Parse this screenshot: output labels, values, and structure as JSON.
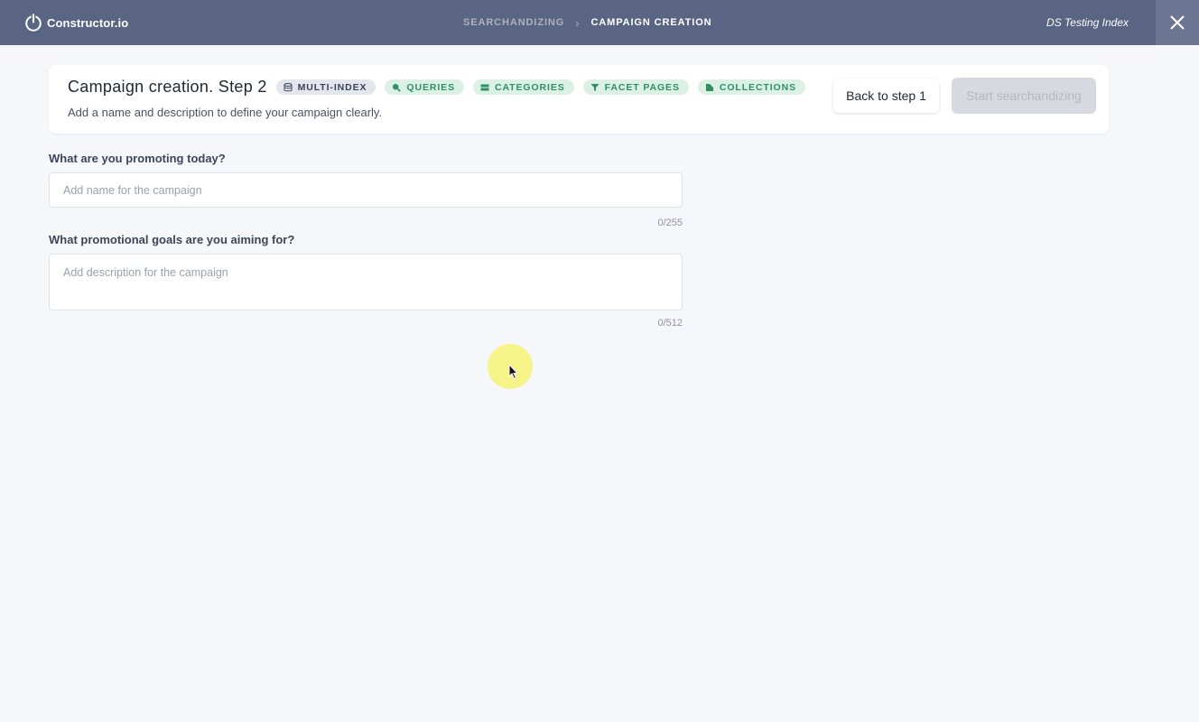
{
  "topbar": {
    "logo_text": "Constructor.io",
    "breadcrumb": [
      "SEARCHANDIZING",
      "CAMPAIGN CREATION"
    ],
    "breadcrumb_separator": "›",
    "index_name": "DS Testing Index"
  },
  "header": {
    "title": "Campaign creation. Step 2",
    "subtitle": "Add a name and description to define your campaign clearly.",
    "chips": [
      {
        "label": "MULTI-INDEX",
        "icon": "database-icon"
      },
      {
        "label": "QUERIES",
        "icon": "search-icon"
      },
      {
        "label": "CATEGORIES",
        "icon": "list-icon"
      },
      {
        "label": "FACET PAGES",
        "icon": "filter-icon"
      },
      {
        "label": "COLLECTIONS",
        "icon": "collection-icon"
      }
    ],
    "back_button": "Back to step 1",
    "start_button": "Start searchandizing"
  },
  "form": {
    "name_label": "What are you promoting today?",
    "name_placeholder": "Add name for the campaign",
    "name_value": "",
    "name_counter": "0/255",
    "desc_label": "What promotional goals are you aiming for?",
    "desc_placeholder": "Add description for the campaign",
    "desc_value": "",
    "desc_counter": "0/512"
  },
  "colors": {
    "topbar": "#5a6584",
    "chip_green_bg": "#dcf1e6",
    "chip_green_text": "#2f8f63",
    "disabled_button": "#d6d9e0",
    "background": "#f5f7fa"
  }
}
